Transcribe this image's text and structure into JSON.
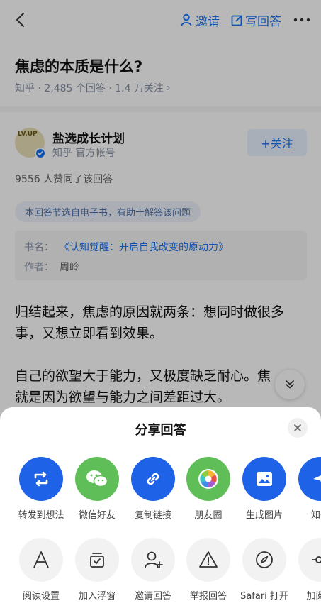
{
  "header": {
    "invite_label": "邀请",
    "write_answer_label": "写回答"
  },
  "question": {
    "title": "焦虑的本质是什么?",
    "meta": "知乎 · 2,485 个回答 · 1.4 万关注",
    "meta_arrow": "›"
  },
  "author": {
    "avatar_text": "LV.UP",
    "name": "盐选成长计划",
    "subtitle": "知乎 官方帐号",
    "follow_label": "+关注"
  },
  "answer": {
    "votes": "9556 人赞同了该回答",
    "excerpt_note": "本回答节选自电子书，有助于解答该问题",
    "book_key": "书名：",
    "book_title": "《认知觉醒：开启自我改变的原动力》",
    "author_key": "作者：",
    "book_author": "周岭",
    "paragraph1_line1": "归结起来，焦虑的原因就两条：想同时做很多",
    "paragraph1_line2": "事，又想立即看到效果。",
    "paragraph2_line1": "自己的欲望大于能力，又极度缺乏耐心。焦",
    "paragraph2_line2": "就是因为欲望与能力之间差距过大。"
  },
  "share_sheet": {
    "title": "分享回答",
    "row1": [
      {
        "label": "转发到想法",
        "icon": "repost-icon"
      },
      {
        "label": "微信好友",
        "icon": "wechat-icon"
      },
      {
        "label": "复制链接",
        "icon": "link-icon"
      },
      {
        "label": "朋友圈",
        "icon": "moments-icon"
      },
      {
        "label": "生成图片",
        "icon": "image-icon"
      },
      {
        "label": "知乎",
        "icon": "send-icon"
      }
    ],
    "row2": [
      {
        "label": "阅读设置",
        "icon": "font-icon"
      },
      {
        "label": "加入浮窗",
        "icon": "float-window-icon"
      },
      {
        "label": "邀请回答",
        "icon": "invite-user-icon"
      },
      {
        "label": "举报回答",
        "icon": "warning-icon"
      },
      {
        "label": "Safari 打开",
        "icon": "compass-icon"
      },
      {
        "label": "加阅读",
        "icon": "key-icon"
      }
    ]
  },
  "colors": {
    "accent_blue": "#1772f6",
    "share_blue": "#1e62e8",
    "wechat_green": "#5fbe57"
  }
}
